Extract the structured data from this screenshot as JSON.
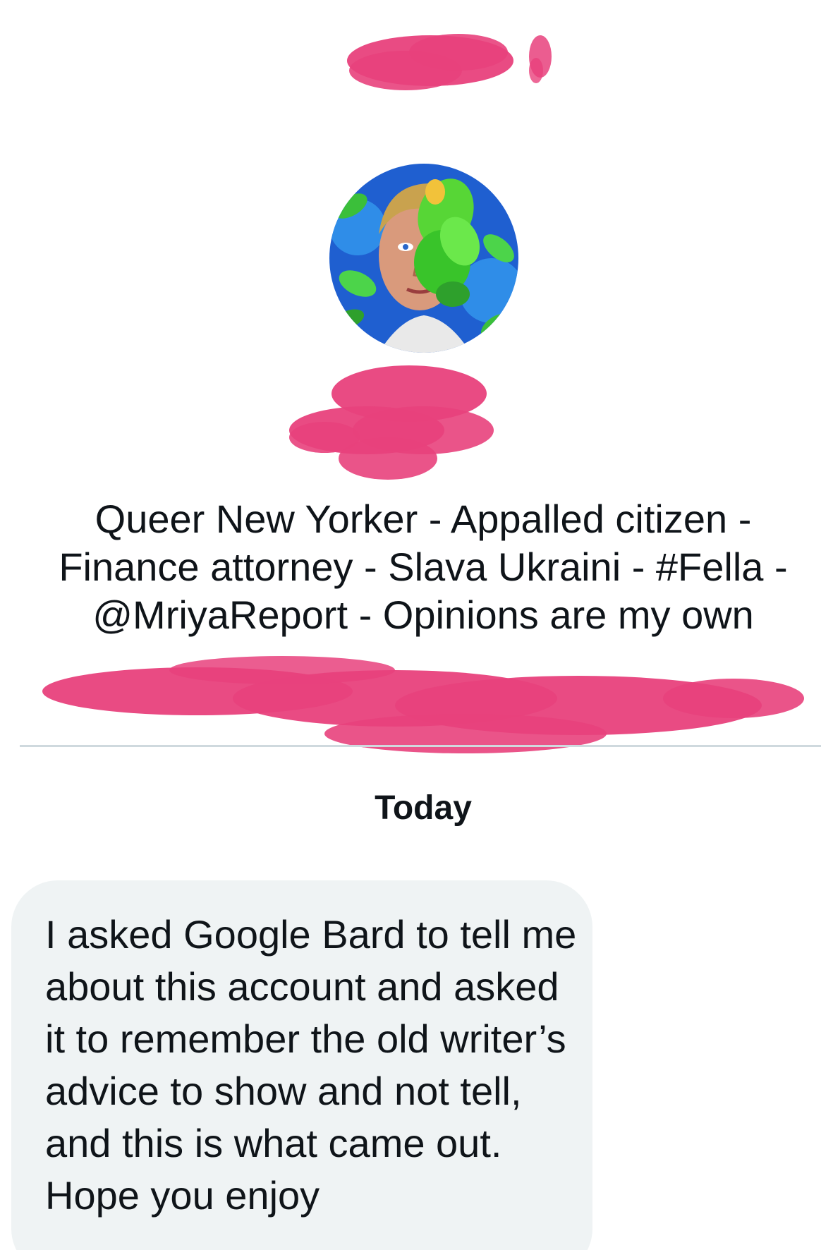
{
  "profile": {
    "bio": "Queer New Yorker - Appalled citizen -\nFinance attorney - Slava Ukraini - #Fella -\n@MriyaReport - Opinions are my own"
  },
  "conversation": {
    "date_label": "Today",
    "messages": [
      {
        "text": "I asked Google Bard to tell me about this account  and asked it to remember the old writer’s advice to show and not tell, and this is what came out. Hope you enjoy"
      }
    ]
  },
  "colors": {
    "redaction": "#e8417c",
    "bubble_background": "#eff3f4",
    "divider": "#cfd9de",
    "text_primary": "#0f1419",
    "text_secondary": "#536471"
  },
  "icons": {
    "avatar": "profile-avatar-illustration"
  }
}
